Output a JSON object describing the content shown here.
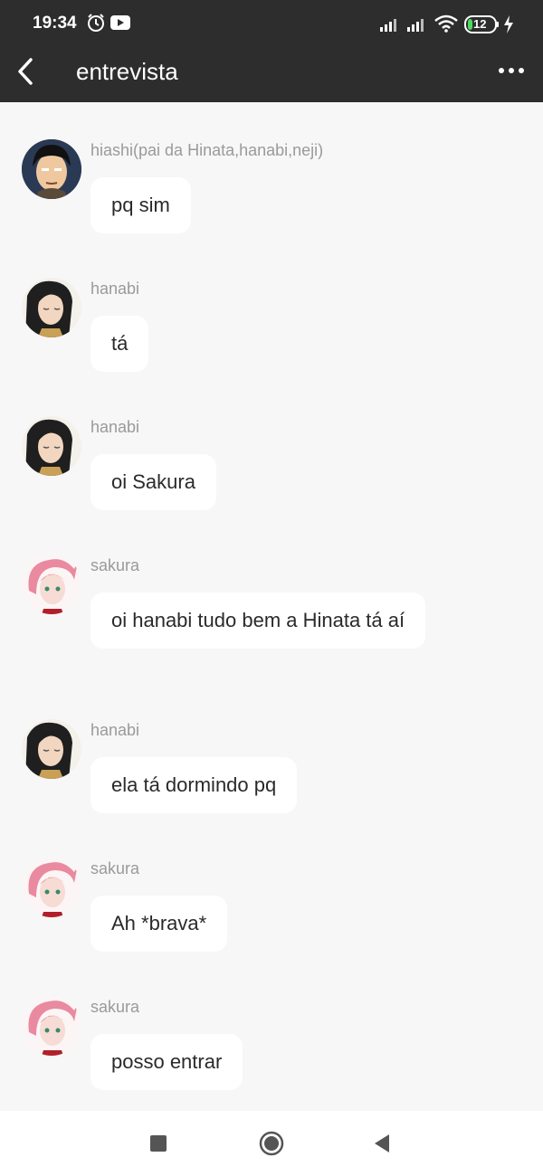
{
  "status_bar": {
    "time": "19:34",
    "battery": "12"
  },
  "header": {
    "title": "entrevista"
  },
  "messages": [
    {
      "sender": "hiashi(pai da Hinata,hanabi,neji)",
      "text": "pq sim",
      "avatar": "hiashi"
    },
    {
      "sender": "hanabi",
      "text": "tá",
      "avatar": "hanabi"
    },
    {
      "sender": "hanabi",
      "text": "oi Sakura",
      "avatar": "hanabi"
    },
    {
      "sender": "sakura",
      "text": "oi hanabi tudo bem a Hinata tá aí",
      "avatar": "sakura"
    },
    {
      "sender": "hanabi",
      "text": "ela tá dormindo pq",
      "avatar": "hanabi"
    },
    {
      "sender": "sakura",
      "text": "Ah *brava*",
      "avatar": "sakura"
    },
    {
      "sender": "sakura",
      "text": "posso entrar",
      "avatar": "sakura"
    }
  ],
  "colors": {
    "header_bg": "#2d2d2d",
    "page_bg": "#f7f7f7",
    "bubble_bg": "#ffffff",
    "sender_text": "#9a9a9a"
  },
  "icons": [
    "alarm-icon",
    "youtube-icon",
    "signal-icon",
    "wifi-icon",
    "battery-icon",
    "charging-icon",
    "back-arrow-icon",
    "more-icon",
    "nav-recents-icon",
    "nav-home-icon",
    "nav-back-icon"
  ]
}
